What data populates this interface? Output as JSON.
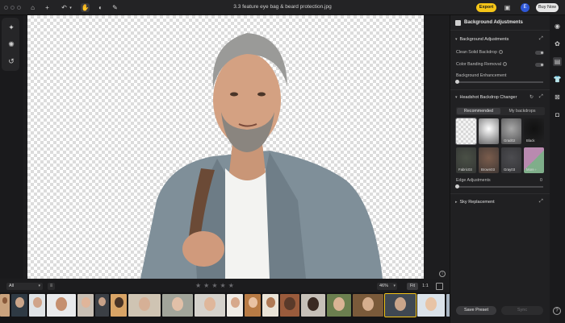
{
  "window": {
    "title": "3.3 feature eye bag & beard protection.jpg"
  },
  "topbar": {
    "export_label": "Export",
    "avatar_initial": "E",
    "buy_now_label": "Buy Now",
    "colors": {
      "export": "#f5c518",
      "avatar": "#2e57d6"
    }
  },
  "panel": {
    "title": "Background Adjustments",
    "background_adjustments": {
      "section_label": "Background Adjustments",
      "clean_solid_backdrop": "Clean Solid Backdrop",
      "color_banding_removal": "Color Banding Removal",
      "background_enhancement": "Background Enhancement",
      "background_enhancement_value": 0
    },
    "headshot": {
      "section_label": "Headshot Backdrop Changer",
      "tab_recommended": "Recommended",
      "tab_my_backdrops": "My backdrops",
      "swatches": [
        {
          "label": "",
          "color": "#e8e8e8"
        },
        {
          "label": "",
          "color": "#ffffff"
        },
        {
          "label": "Grad02",
          "color": "#a8a8a8"
        },
        {
          "label": "Black",
          "color": "#111111"
        },
        {
          "label": "Fabric03",
          "color": "#4a5046"
        },
        {
          "label": "Brown03",
          "color": "#7a5c4c"
        },
        {
          "label": "Gray03",
          "color": "#4c4c50"
        },
        {
          "label": "More",
          "color": "#6d6d6d"
        }
      ],
      "edge_adjustments": "Edge Adjustments",
      "edge_value": "0"
    },
    "sky": {
      "section_label": "Sky Replacement"
    },
    "save_preset_label": "Save Preset",
    "sync_label": "Sync"
  },
  "filmstrip": {
    "filter_value": "All",
    "zoom_value": "46%",
    "fit_label": "Fit",
    "one_to_one_label": "1:1",
    "rating_stars": "★★★★★",
    "thumbnails": [
      {
        "bg": "#c9a27d",
        "skin": "#8a5a3a"
      },
      {
        "bg": "#2f3a44",
        "skin": "#caa58a"
      },
      {
        "bg": "#dfe3e6",
        "skin": "#d0a48a"
      },
      {
        "bg": "#e9eaec",
        "skin": "#c58f6f"
      },
      {
        "bg": "#c8bfb4",
        "skin": "#e0b59a"
      },
      {
        "bg": "#3b3f45",
        "skin": "#c7a188"
      },
      {
        "bg": "#d9a466",
        "skin": "#4a3426"
      },
      {
        "bg": "#cfc4b3",
        "skin": "#d6b096"
      },
      {
        "bg": "#a2a59b",
        "skin": "#e1c0a8"
      },
      {
        "bg": "#d5d2cc",
        "skin": "#dfb79b"
      },
      {
        "bg": "#f0ece6",
        "skin": "#d7a98c"
      },
      {
        "bg": "#b87b45",
        "skin": "#e9c2a3"
      },
      {
        "bg": "#eae4d8",
        "skin": "#b07a55"
      },
      {
        "bg": "#9a5b3c",
        "skin": "#5a3a2a"
      },
      {
        "bg": "#c6c0b8",
        "skin": "#3a2a22"
      },
      {
        "bg": "#6b7f4f",
        "skin": "#d9b394"
      },
      {
        "bg": "#7a5a3a",
        "skin": "#d5ae8e"
      },
      {
        "bg": "#3f4852",
        "skin": "#c9a58a"
      },
      {
        "bg": "#dbe3ea",
        "skin": "#e8c4a6"
      },
      {
        "bg": "#a7b4c2",
        "skin": "#d8b092"
      },
      {
        "bg": "#b9b3ac",
        "skin": "#d2a788"
      }
    ]
  }
}
